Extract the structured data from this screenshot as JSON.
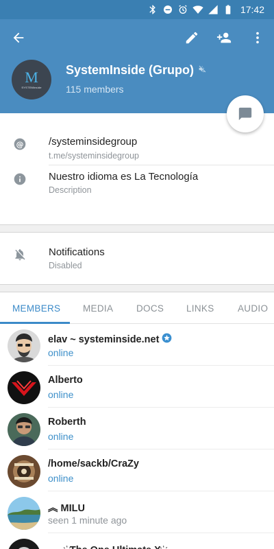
{
  "status_bar": {
    "time": "17:42",
    "icons": [
      "bluetooth-icon",
      "dnd-icon",
      "alarm-icon",
      "wifi-icon",
      "signal-icon",
      "battery-icon"
    ]
  },
  "toolbar": {
    "icons": [
      "back-arrow-icon",
      "edit-pencil-icon",
      "add-user-icon",
      "more-vert-icon"
    ]
  },
  "group": {
    "logo_letter": "M",
    "logo_sub": "SYSTEMinside",
    "title": "SystemInside (Grupo)",
    "members": "115 members",
    "muted_icon": "mute-icon"
  },
  "info": {
    "username": "/systeminsidegroup",
    "link": "t.me/systeminsidegroup",
    "description": "Nuestro idioma es La Tecnología",
    "description_label": "Description"
  },
  "notifications": {
    "label": "Notifications",
    "value": "Disabled"
  },
  "tabs": [
    {
      "label": "MEMBERS",
      "active": true
    },
    {
      "label": "MEDIA",
      "active": false
    },
    {
      "label": "DOCS",
      "active": false
    },
    {
      "label": "LINKS",
      "active": false
    },
    {
      "label": "AUDIO",
      "active": false
    }
  ],
  "members": [
    {
      "name": "elav ~ systeminside.net",
      "status": "online",
      "verified": true
    },
    {
      "name": "Alberto",
      "status": "online",
      "verified": false
    },
    {
      "name": "Roberth",
      "status": "online",
      "verified": false
    },
    {
      "name": "/home/sackb/CraZy",
      "status": "online",
      "verified": false
    },
    {
      "name": "︽ MILU",
      "status": "seen 1 minute ago",
      "verified": false
    },
    {
      "name": "—ﾠ҉ The One Ultimate X ҉ ﾠ—",
      "status": "",
      "verified": false
    }
  ],
  "colors": {
    "header": "#4a8cc0",
    "status_bar": "#3a7fb2",
    "accent": "#3b8ac8",
    "online": "#3d8fc9"
  }
}
